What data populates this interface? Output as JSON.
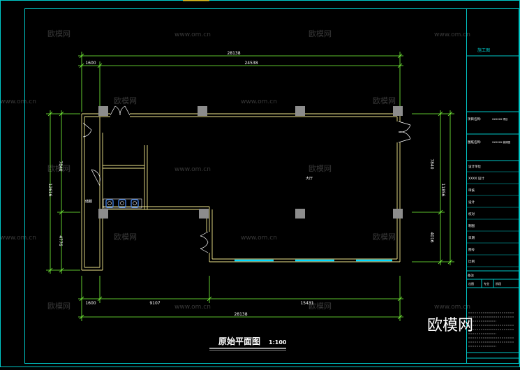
{
  "drawing": {
    "title": "原始平面图",
    "scale": "1:100",
    "room_hall": "大厅",
    "room_storage": "储藏",
    "top_dims": {
      "total": "28138",
      "left": "1600",
      "main": "24538"
    },
    "bottom_dims": {
      "total": "28138",
      "left": "1600",
      "mid": "9107",
      "right": "15431"
    },
    "left_dims": {
      "total": "12616",
      "upper": "7840",
      "lower": "4776"
    },
    "right_dims": {
      "total": "11856",
      "upper": "7840",
      "lower": "4016"
    }
  },
  "watermark": {
    "site": "www.om.cn",
    "brand": "欧模网"
  },
  "title_block": {
    "header": "施工图",
    "project_label": "项目名称:",
    "project_value": "XXXXXX 项目",
    "drawing_label": "图纸名称:",
    "drawing_value": "XXXXXX 装修图",
    "small_fields": [
      "设计单位",
      "XXXX 设计",
      "审核",
      "设计",
      "校对",
      "制图",
      "日期",
      "图号",
      "比例"
    ],
    "stamp_label": "备注",
    "stamp_fields": [
      "出图",
      "专业",
      "阶段"
    ]
  },
  "colors": {
    "frame": "#00c8c8",
    "wall": "#f0e68c",
    "dim": "#7cff3c",
    "text": "#ffffff",
    "column": "#8c8c8c",
    "window": "#00d7ff",
    "fixture": "#4a90ff",
    "watermark": "#3a3a3a"
  }
}
